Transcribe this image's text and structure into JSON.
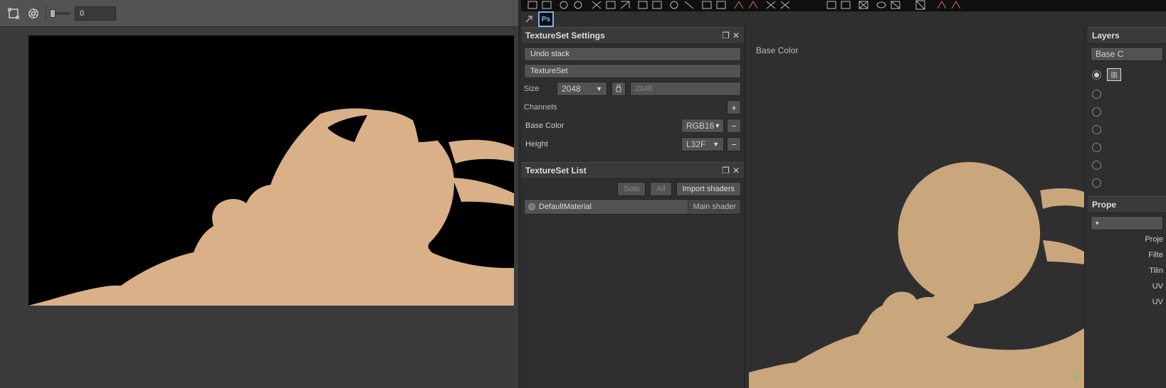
{
  "left": {
    "slider_value": "0"
  },
  "tsSettings": {
    "title": "TextureSet Settings",
    "undo": "Undo stack",
    "ts_btn": "TextureSet",
    "size_label": "Size",
    "size_value": "2048",
    "size_linked": "2048",
    "channels_label": "Channels",
    "channels": [
      {
        "name": "Base Color",
        "fmt": "RGB16"
      },
      {
        "name": "Height",
        "fmt": "L32F"
      }
    ]
  },
  "tsList": {
    "title": "TextureSet List",
    "solo": "Solo",
    "all": "All",
    "import": "Import shaders",
    "material": "DefaultMaterial",
    "shader": "Main shader"
  },
  "viewport": {
    "label": "Base Color",
    "axis": "Y"
  },
  "layers": {
    "title": "Layers",
    "mode": "Base C"
  },
  "properties": {
    "title": "Prope",
    "rows": [
      "Proje",
      "Filte",
      "Tilin",
      "UV",
      "UV"
    ]
  }
}
